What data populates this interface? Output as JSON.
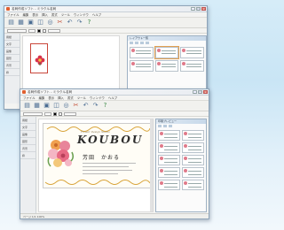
{
  "window_back": {
    "title": "名刺作成ソフト - ミラクル名刺",
    "menus": [
      "ファイル",
      "編集",
      "表示",
      "挿入",
      "書式",
      "ツール",
      "ウィンドウ",
      "ヘルプ"
    ],
    "toolbar_icons": [
      "new-file-icon",
      "open-folder-icon",
      "save-icon",
      "print-icon",
      "preview-icon",
      "cut-icon",
      "undo-icon",
      "redo-icon",
      "help-icon"
    ],
    "side_items": [
      "用紙",
      "文字",
      "画像",
      "図形",
      "背景",
      "枠"
    ],
    "subpanel_title": "レイアウト一覧"
  },
  "window_front": {
    "title": "名刺作成ソフト - ミラクル名刺",
    "menus": [
      "ファイル",
      "編集",
      "表示",
      "挿入",
      "書式",
      "ツール",
      "ウィンドウ",
      "ヘルプ"
    ],
    "toolbar_icons": [
      "new-file-icon",
      "open-folder-icon",
      "save-icon",
      "print-icon",
      "preview-icon",
      "cut-icon",
      "undo-icon",
      "redo-icon",
      "help-icon"
    ],
    "side_items": [
      "用紙",
      "文字",
      "画像",
      "図形",
      "背景",
      "枠"
    ],
    "subpanel_title": "印刷プレビュー",
    "status": "ページ 1/1   100%"
  },
  "card": {
    "company": "KOUBOU",
    "name": "芳田　かおる",
    "small_text": "Flower Design Studio"
  },
  "colors": {
    "accent": "#d9a53c",
    "window_border": "#8ea4b8",
    "flower_pink": "#e8849a",
    "flower_orange": "#f0a050"
  }
}
